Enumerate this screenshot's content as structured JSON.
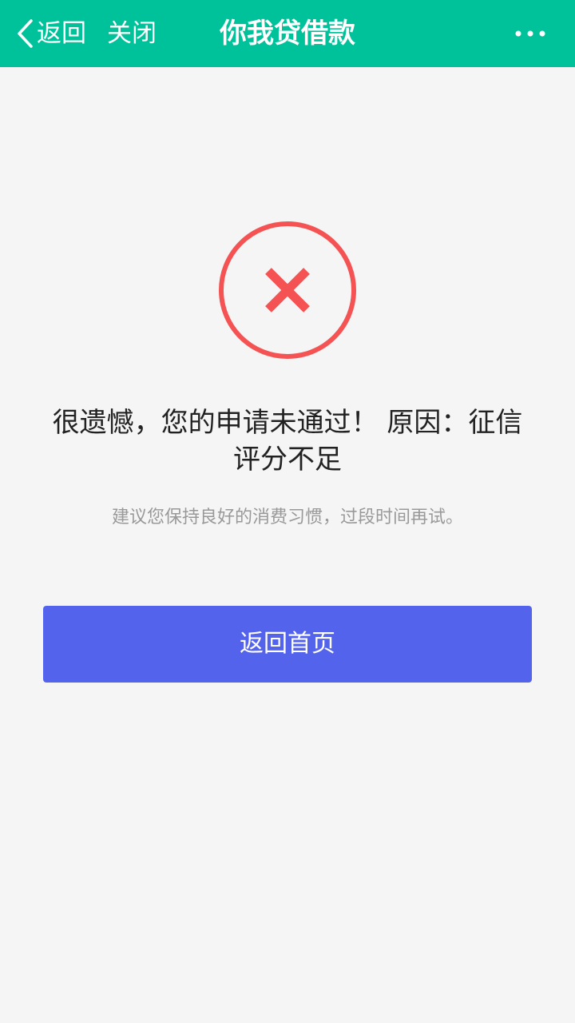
{
  "header": {
    "back_label": "返回",
    "close_label": "关闭",
    "title": "你我贷借款",
    "more_icon": "more-dots-icon",
    "back_icon": "chevron-left-icon",
    "background_color": "#00c29a"
  },
  "result": {
    "icon": "error-cross-icon",
    "icon_color": "#f55353",
    "message": "很遗憾，您的申请未通过！ 原因：征信评分不足",
    "suggestion": "建议您保持良好的消费习惯，过段时间再试。"
  },
  "actions": {
    "home_label": "返回首页",
    "home_color": "#5463ec"
  }
}
